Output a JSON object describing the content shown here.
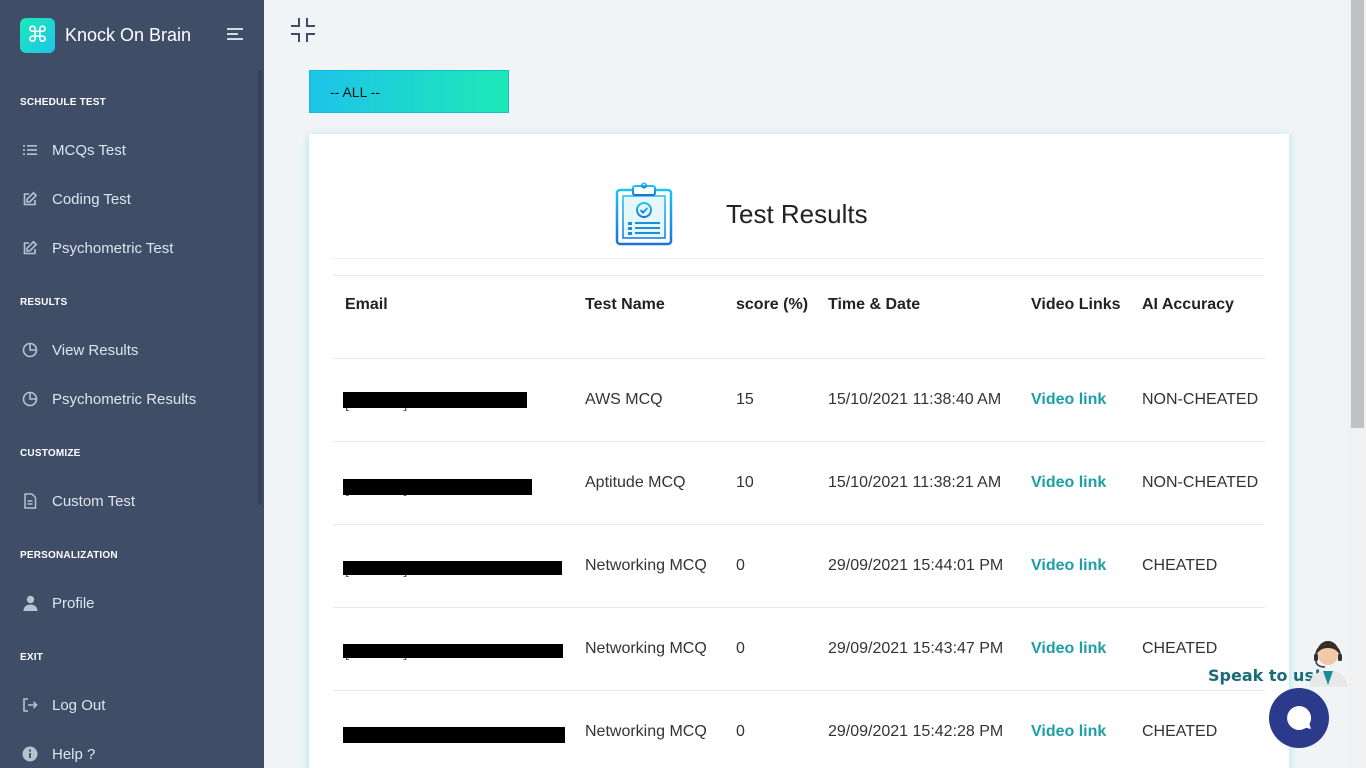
{
  "brand": {
    "name": "Knock On Brain",
    "logo_icon": "command-icon"
  },
  "sidebar": {
    "sections": [
      {
        "title": "SCHEDULE TEST",
        "items": [
          {
            "label": "MCQs Test",
            "icon": "list-icon"
          },
          {
            "label": "Coding Test",
            "icon": "edit-icon"
          },
          {
            "label": "Psychometric Test",
            "icon": "edit-icon"
          }
        ]
      },
      {
        "title": "RESULTS",
        "items": [
          {
            "label": "View Results",
            "icon": "pie-chart-icon"
          },
          {
            "label": "Psychometric Results",
            "icon": "pie-chart-icon"
          }
        ]
      },
      {
        "title": "CUSTOMIZE",
        "items": [
          {
            "label": "Custom Test",
            "icon": "file-icon"
          }
        ]
      },
      {
        "title": "PERSONALIZATION",
        "items": [
          {
            "label": "Profile",
            "icon": "user-icon"
          }
        ]
      },
      {
        "title": "EXIT",
        "items": [
          {
            "label": "Log Out",
            "icon": "logout-icon"
          },
          {
            "label": "Help ?",
            "icon": "info-icon"
          }
        ]
      }
    ]
  },
  "filter": {
    "label": "-- ALL --"
  },
  "results": {
    "title": "Test Results",
    "columns": [
      "Email",
      "Test Name",
      "score (%)",
      "Time & Date",
      "Video Links",
      "AI Accuracy"
    ],
    "rows": [
      {
        "email": "[redacted]",
        "test_name": "AWS MCQ",
        "score": "15",
        "datetime": "15/10/2021 11:38:40 AM",
        "video": "Video link",
        "accuracy": "NON-CHEATED"
      },
      {
        "email": "[redacted]",
        "test_name": "Aptitude MCQ",
        "score": "10",
        "datetime": "15/10/2021 11:38:21 AM",
        "video": "Video link",
        "accuracy": "NON-CHEATED"
      },
      {
        "email": "[redacted]",
        "test_name": "Networking MCQ",
        "score": "0",
        "datetime": "29/09/2021 15:44:01 PM",
        "video": "Video link",
        "accuracy": "CHEATED"
      },
      {
        "email": "[redacted]",
        "test_name": "Networking MCQ",
        "score": "0",
        "datetime": "29/09/2021 15:43:47 PM",
        "video": "Video link",
        "accuracy": "CHEATED"
      },
      {
        "email": "[redacted]",
        "test_name": "Networking MCQ",
        "score": "0",
        "datetime": "29/09/2021 15:42:28 PM",
        "video": "Video link",
        "accuracy": "CHEATED"
      }
    ]
  },
  "chat": {
    "label": "Speak to us!"
  },
  "colors": {
    "sidebar_bg": "#3f4d67",
    "accent_start": "#1dc4e9",
    "accent_end": "#1de9b6",
    "link": "#1b9fa8",
    "chat_btn": "#2c3a8c"
  }
}
